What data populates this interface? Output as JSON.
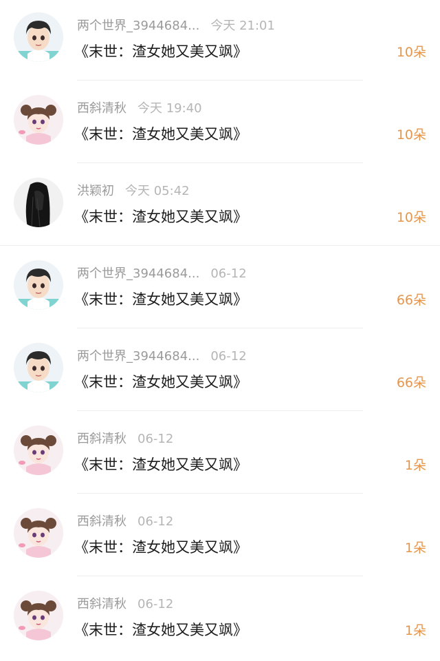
{
  "gifts": [
    {
      "user": "两个世界_3944684...",
      "time": "今天 21:01",
      "book": "《末世：渣女她又美又飒》",
      "amount": "10朵",
      "avatar": "boy-avatar-icon"
    },
    {
      "user": "西斜清秋",
      "time": "今天 19:40",
      "book": "《末世：渣女她又美又飒》",
      "amount": "10朵",
      "avatar": "girl-buns-avatar-icon"
    },
    {
      "user": "洪颖初",
      "time": "今天 05:42",
      "book": "《末世：渣女她又美又飒》",
      "amount": "10朵",
      "avatar": "long-hair-avatar-icon"
    },
    {
      "user": "两个世界_3944684...",
      "time": "06-12",
      "book": "《末世：渣女她又美又飒》",
      "amount": "66朵",
      "avatar": "boy-avatar-icon"
    },
    {
      "user": "两个世界_3944684...",
      "time": "06-12",
      "book": "《末世：渣女她又美又飒》",
      "amount": "66朵",
      "avatar": "boy-avatar-icon"
    },
    {
      "user": "西斜清秋",
      "time": "06-12",
      "book": "《末世：渣女她又美又飒》",
      "amount": "1朵",
      "avatar": "girl-buns-avatar-icon"
    },
    {
      "user": "西斜清秋",
      "time": "06-12",
      "book": "《末世：渣女她又美又飒》",
      "amount": "1朵",
      "avatar": "girl-buns-avatar-icon"
    },
    {
      "user": "西斜清秋",
      "time": "06-12",
      "book": "《末世：渣女她又美又飒》",
      "amount": "1朵",
      "avatar": "girl-buns-avatar-icon"
    }
  ],
  "colors": {
    "amount": "#e5964c",
    "meta": "#9a9a9a",
    "title": "#1c1c1c"
  }
}
